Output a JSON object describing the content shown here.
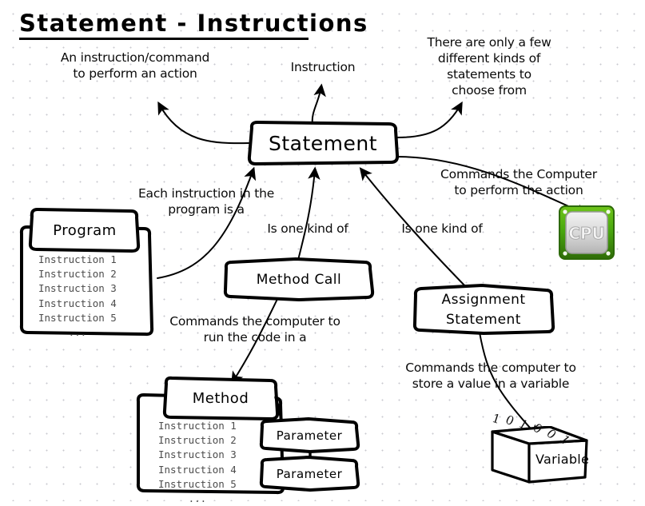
{
  "page": {
    "title": "Statement - Instructions",
    "background": "#ffffff",
    "grid_dot_color": "#c9c9cf",
    "ink_color": "#000000"
  },
  "nodes": {
    "statement": {
      "label": "Statement"
    },
    "method_call": {
      "label": "Method Call"
    },
    "assignment_statement": {
      "label": "Assignment\nStatement"
    },
    "program": {
      "tab_label": "Program",
      "code_lines": [
        "Instruction 1",
        "Instruction 2",
        "Instruction 3",
        "Instruction 4",
        "Instruction 5",
        "     ..."
      ]
    },
    "method": {
      "tab_label": "Method",
      "code_lines": [
        "Instruction 1",
        "Instruction 2",
        "Instruction 3",
        "Instruction 4",
        "Instruction 5",
        "     ..."
      ]
    },
    "parameter_1": {
      "label": "Parameter"
    },
    "parameter_2": {
      "label": "Parameter"
    },
    "cpu": {
      "label": "CPU",
      "body_color": "#4aa80e",
      "chip_color": "#d9d9d9"
    },
    "variable": {
      "label": "Variable",
      "bits": "101001"
    }
  },
  "annotations": {
    "instruction_command": "An instruction/command\nto perform an action",
    "instruction": "Instruction",
    "few_kinds": "There are only a few\ndifferent kinds of\nstatements to\nchoose from",
    "commands_computer_action": "Commands the Computer\nto perform the action",
    "each_instruction": "Each instruction in the\nprogram is a",
    "is_one_kind_of_left": "Is one kind of",
    "is_one_kind_of_right": "Is one kind of",
    "commands_run_code": "Commands the computer to\nrun the code in a",
    "commands_store_value": "Commands the computer to\nstore a value in a variable"
  }
}
